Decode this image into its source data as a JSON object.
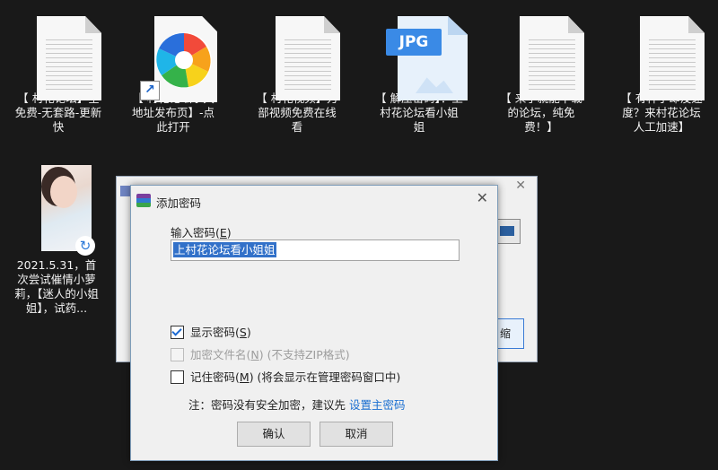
{
  "desktop": {
    "files": [
      {
        "label": "【 村花论坛】全免费-无套路-更新快",
        "icon": "document-icon"
      },
      {
        "label": "【 村花论坛永久地址发布页】-点此打开",
        "icon": "browser-shortcut-icon"
      },
      {
        "label": "【 村花视频】万部视频免费在线看",
        "icon": "document-icon"
      },
      {
        "label": "【 解压密码】：上村花论坛看小姐姐",
        "icon": "jpg-file-icon",
        "badge": "JPG"
      },
      {
        "label": "【 来了就能下载的论坛，纯免费！】",
        "icon": "document-icon"
      },
      {
        "label": "【 有种子却没速度？来村花论坛人工加速】",
        "icon": "document-icon"
      },
      {
        "label": "2021.5.31，首次尝试催情小萝莉，【迷人的小姐姐】，试药...",
        "icon": "photo-thumbnail-icon"
      }
    ]
  },
  "background_dialog": {
    "button_partial": "缩",
    "close": "✕"
  },
  "dialog": {
    "title": "添加密码",
    "close": "✕",
    "password_label": "输入密码(",
    "password_label_key": "E",
    "password_label_end": ")",
    "password_value": "上村花论坛看小姐姐",
    "options": [
      {
        "label": "显示密码(",
        "key": "S",
        "suffix": ")",
        "checked": true,
        "disabled": false
      },
      {
        "label": "加密文件名(",
        "key": "N",
        "suffix": ") (不支持ZIP格式)",
        "checked": false,
        "disabled": true
      },
      {
        "label": "记住密码(",
        "key": "M",
        "suffix": ") (将会显示在管理密码窗口中)",
        "checked": false,
        "disabled": false
      }
    ],
    "note_text": "注：密码没有安全加密，建议先 ",
    "note_link": "设置主密码",
    "ok_label": "确认",
    "cancel_label": "取消"
  },
  "colors": {
    "desktop_bg": "#191919",
    "selection": "#3271c9",
    "link": "#1a6fd1",
    "jpg_badge": "#3a8ae6"
  }
}
